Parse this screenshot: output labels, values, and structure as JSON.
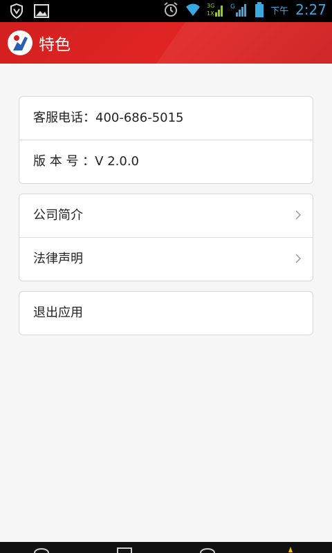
{
  "statusbar": {
    "ampm": "下午",
    "time": "2:27",
    "network_3g": "3G",
    "network_1x": "1X",
    "network_g": "G"
  },
  "appbar": {
    "title": "特色",
    "accent": "#d31f1f"
  },
  "groups": {
    "info": [
      {
        "label": "客服电话：400-686-5015"
      },
      {
        "label": "版 本 号 ：V 2.0.0"
      }
    ],
    "links": [
      {
        "label": "公司简介"
      },
      {
        "label": "法律声明"
      }
    ],
    "exit": [
      {
        "label": "退出应用"
      }
    ]
  }
}
